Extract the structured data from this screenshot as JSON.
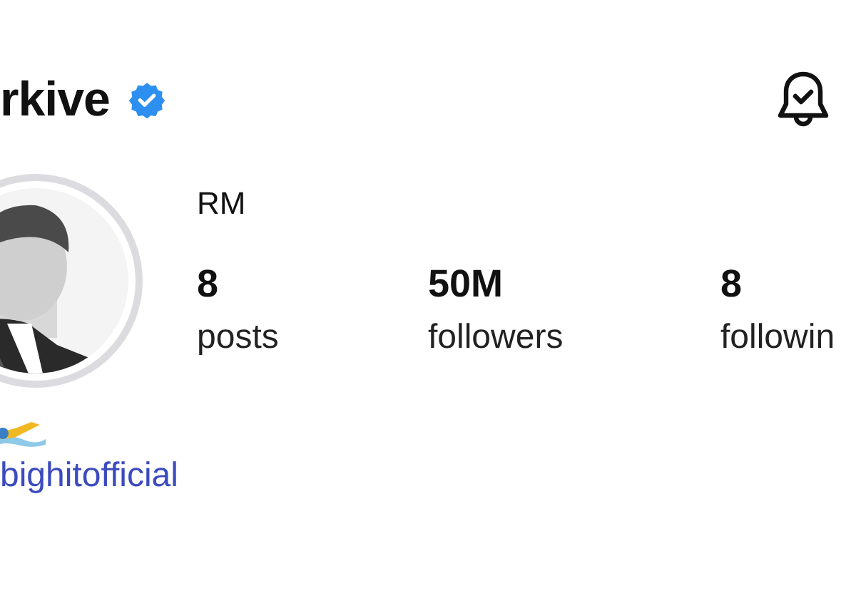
{
  "header": {
    "username": "rkive",
    "verified": true
  },
  "profile": {
    "name": "RM",
    "stats": [
      {
        "value": "8",
        "label": "posts"
      },
      {
        "value": "50M",
        "label": "followers"
      },
      {
        "value": "8",
        "label": "followin"
      }
    ]
  },
  "bio": {
    "link": "bighitofficial"
  }
}
